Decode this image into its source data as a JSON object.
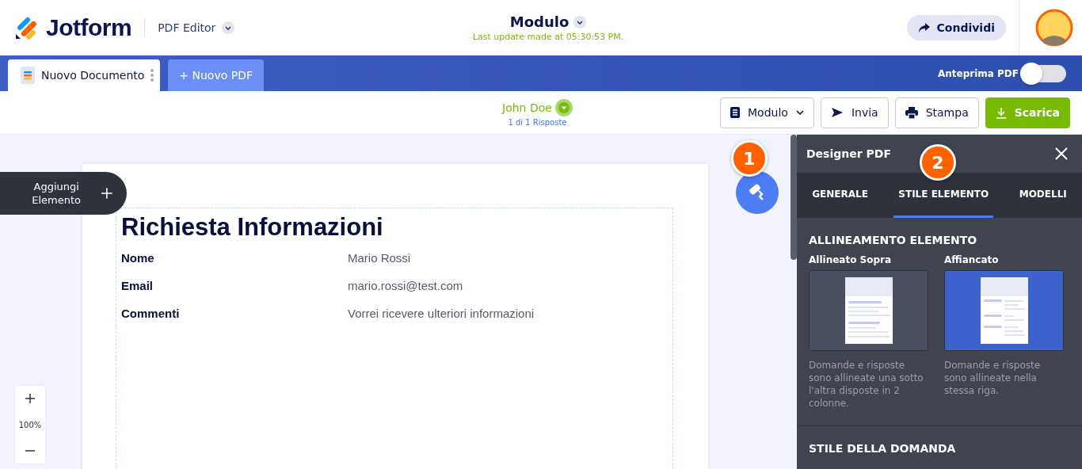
{
  "header": {
    "logo": "Jotform",
    "product": "PDF Editor",
    "title": "Modulo",
    "last_update": "Last update made at 05:30:53 PM.",
    "share": "Condividi"
  },
  "doc_tabs": [
    {
      "label": "Nuovo Documento",
      "selected": true
    }
  ],
  "new_pdf": "+ Nuovo PDF",
  "preview": {
    "label": "Anteprima PDF",
    "on": false
  },
  "toolbar": {
    "respondent": "John Doe",
    "count": "1 di 1 Risposte",
    "buttons": [
      {
        "kind": "dropdown",
        "label": "Modulo"
      },
      {
        "kind": "send",
        "label": "Invia"
      },
      {
        "kind": "print",
        "label": "Stampa"
      },
      {
        "kind": "download",
        "label": "Scarica"
      }
    ]
  },
  "add_element": "Aggiungi Elemento",
  "zoom": "100%",
  "document": {
    "title": "Richiesta Informazioni",
    "fields": [
      {
        "label": "Nome",
        "value": "Mario Rossi"
      },
      {
        "label": "Email",
        "value": "mario.rossi@test.com"
      },
      {
        "label": "Commenti",
        "value": "Vorrei ricevere ulteriori informazioni"
      }
    ]
  },
  "callouts": [
    "1",
    "2"
  ],
  "panel": {
    "title": "Designer PDF",
    "tabs": [
      {
        "label": "GENERALE",
        "selected": false
      },
      {
        "label": "STILE ELEMENTO",
        "selected": true
      },
      {
        "label": "MODELLI",
        "selected": false
      }
    ],
    "section": "ALLINEAMENTO ELEMENTO",
    "options": [
      {
        "kind": "stacked",
        "label": "Allineato Sopra",
        "description": "Domande e risposte sono allineate una sotto l'altra disposte in 2 colonne.",
        "selected": false
      },
      {
        "kind": "side",
        "label": "Affiancato",
        "description": "Domande e risposte sono allineate nella stessa riga.",
        "selected": true
      }
    ],
    "next_section": "STILE DELLA DOMANDA"
  }
}
